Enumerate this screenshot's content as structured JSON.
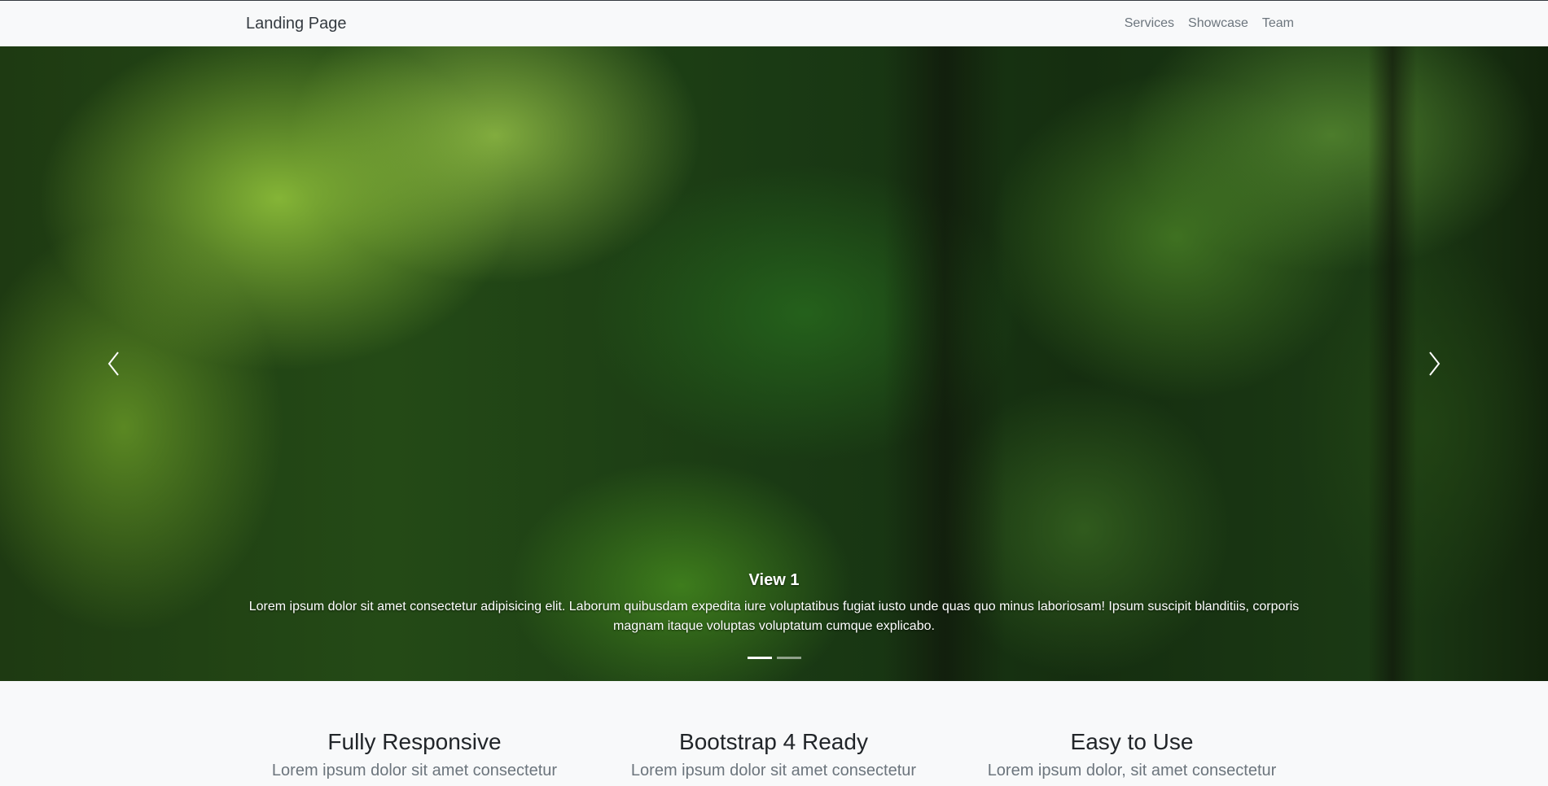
{
  "navbar": {
    "brand": "Landing Page",
    "links": [
      "Services",
      "Showcase",
      "Team"
    ]
  },
  "carousel": {
    "caption_title": "View 1",
    "caption_text": "Lorem ipsum dolor sit amet consectetur adipisicing elit. Laborum quibusdam expedita iure voluptatibus fugiat iusto unde quas quo minus laboriosam! Ipsum suscipit blanditiis, corporis magnam itaque voluptas voluptatum cumque explicabo.",
    "indicator_count": 2,
    "active_index": 0,
    "image_description_icon": "forest-image"
  },
  "features": [
    {
      "title": "Fully Responsive",
      "text": "Lorem ipsum dolor sit amet consectetur"
    },
    {
      "title": "Bootstrap 4 Ready",
      "text": "Lorem ipsum dolor sit amet consectetur"
    },
    {
      "title": "Easy to Use",
      "text": "Lorem ipsum dolor, sit amet consectetur"
    }
  ],
  "colors": {
    "navbar_bg": "#f8f9fa",
    "brand": "#343a40",
    "nav_link": "#6c757d"
  }
}
